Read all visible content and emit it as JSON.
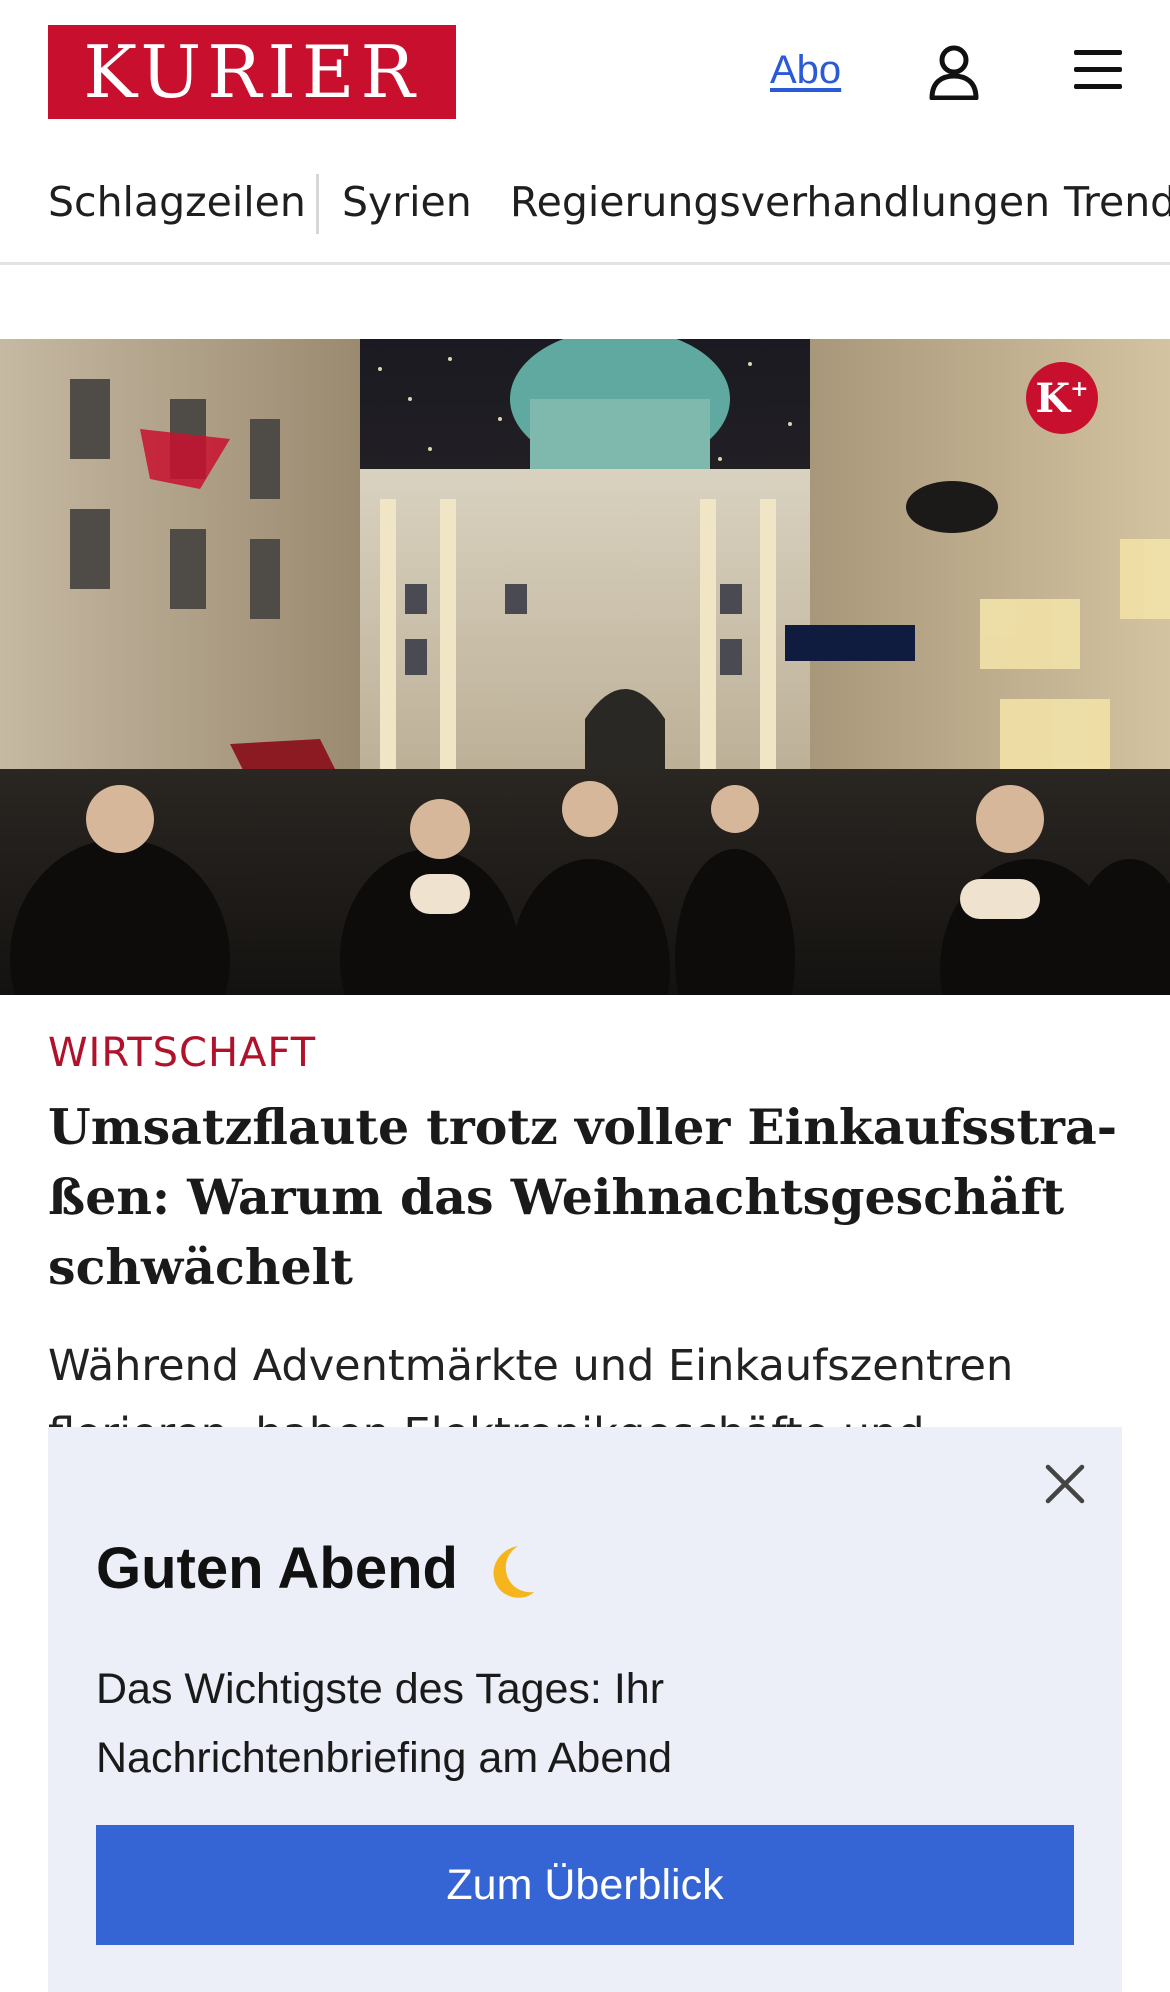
{
  "header": {
    "logo_text": "KURIER",
    "abo_label": "Abo",
    "user_icon": "user-icon",
    "menu_icon": "hamburger-menu-icon"
  },
  "topics": [
    "Schlagzeilen",
    "Syrien",
    "Regierungsverhandlungen",
    "Trend"
  ],
  "hero": {
    "badge_letter": "K",
    "badge_sup": "+"
  },
  "article": {
    "category": "WIRTSCHAFT",
    "headline_lines": [
      "Umsatzflaute trotz voller Einkaufsstra-",
      "ßen: Warum das Weihnachtsgeschäft",
      "schwächelt"
    ],
    "teaser_lines": [
      "Während Adventmärkte und Einkaufszentren",
      "florieren, haben Elektronikgeschäfte und"
    ]
  },
  "popup": {
    "title": "Guten Abend",
    "title_icon": "moon-icon",
    "text_lines": [
      "Das Wichtigste des Tages: Ihr",
      "Nachrichtenbriefing am Abend"
    ],
    "button_label": "Zum Überblick",
    "close_icon": "close-icon"
  },
  "colors": {
    "brand_red": "#c8102e",
    "link_blue": "#2a5bd7",
    "button_blue": "#3565d4",
    "popup_bg": "#eceef8"
  }
}
